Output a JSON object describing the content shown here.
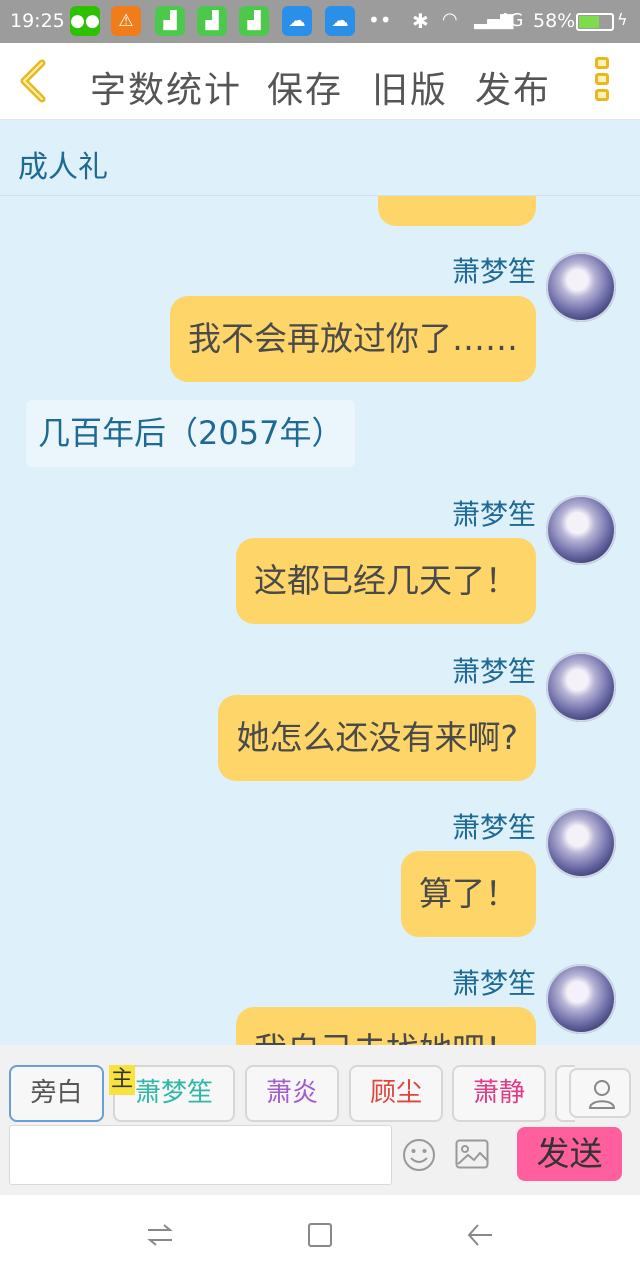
{
  "status_bar": {
    "time": "19:25",
    "network": "4G",
    "battery": "58%",
    "battery_level": 0.58,
    "icons": [
      "wechat-icon",
      "warning-icon",
      "cleaner-icon",
      "cleaner-icon",
      "cleaner-icon",
      "weather-icon",
      "weather-icon",
      "more-dots-icon",
      "bluetooth-icon",
      "wifi-icon",
      "signal-icon",
      "battery-icon"
    ]
  },
  "toolbar": {
    "word_count": "字数统计",
    "save": "保存",
    "old_version": "旧版",
    "publish": "发布"
  },
  "chat": {
    "title": "成人礼",
    "messages": [
      {
        "speaker": "萧梦笙",
        "text": "我不会再放过你了……"
      },
      {
        "speaker": "",
        "text": "几百年后（2057年）",
        "narration": true
      },
      {
        "speaker": "萧梦笙",
        "text": "这都已经几天了！"
      },
      {
        "speaker": "萧梦笙",
        "text": "她怎么还没有来啊?"
      },
      {
        "speaker": "萧梦笙",
        "text": "算了！"
      },
      {
        "speaker": "萧梦笙",
        "text": "我自己去找她吧！"
      }
    ]
  },
  "input": {
    "roles": [
      "旁白",
      "萧梦笙",
      "萧炎",
      "顾尘",
      "萧静"
    ],
    "main_tag": "主",
    "text_value": "",
    "send": "发送"
  },
  "colors": {
    "chat_bg": "#def0fa",
    "bubble": "#fdd569",
    "speaker": "#1e6a93",
    "send": "#ff5f9c",
    "accent": "#e8b820"
  }
}
